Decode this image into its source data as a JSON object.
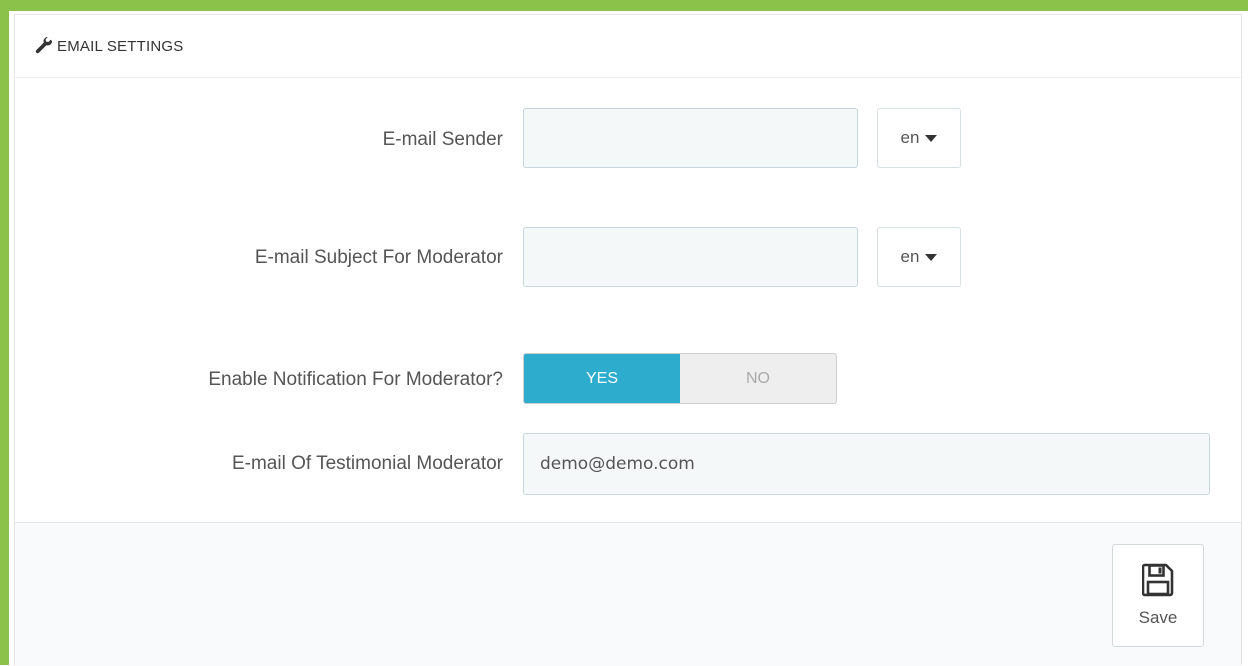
{
  "panel": {
    "title": "EMAIL SETTINGS",
    "heading_icon": "wrench-icon"
  },
  "fields": {
    "sender": {
      "label": "E-mail Sender",
      "value": "",
      "lang": "en"
    },
    "subject": {
      "label": "E-mail Subject For Moderator",
      "value": "",
      "lang": "en"
    },
    "notify": {
      "label": "Enable Notification For Moderator?",
      "yes": "YES",
      "no": "NO",
      "selected": "YES"
    },
    "moderator_email": {
      "label": "E-mail Of Testimonial Moderator",
      "value": "demo@demo.com"
    }
  },
  "footer": {
    "save_label": "Save",
    "save_icon": "floppy-disk-icon"
  },
  "colors": {
    "frame_border": "#8bc34a",
    "toggle_active": "#2eacce"
  }
}
